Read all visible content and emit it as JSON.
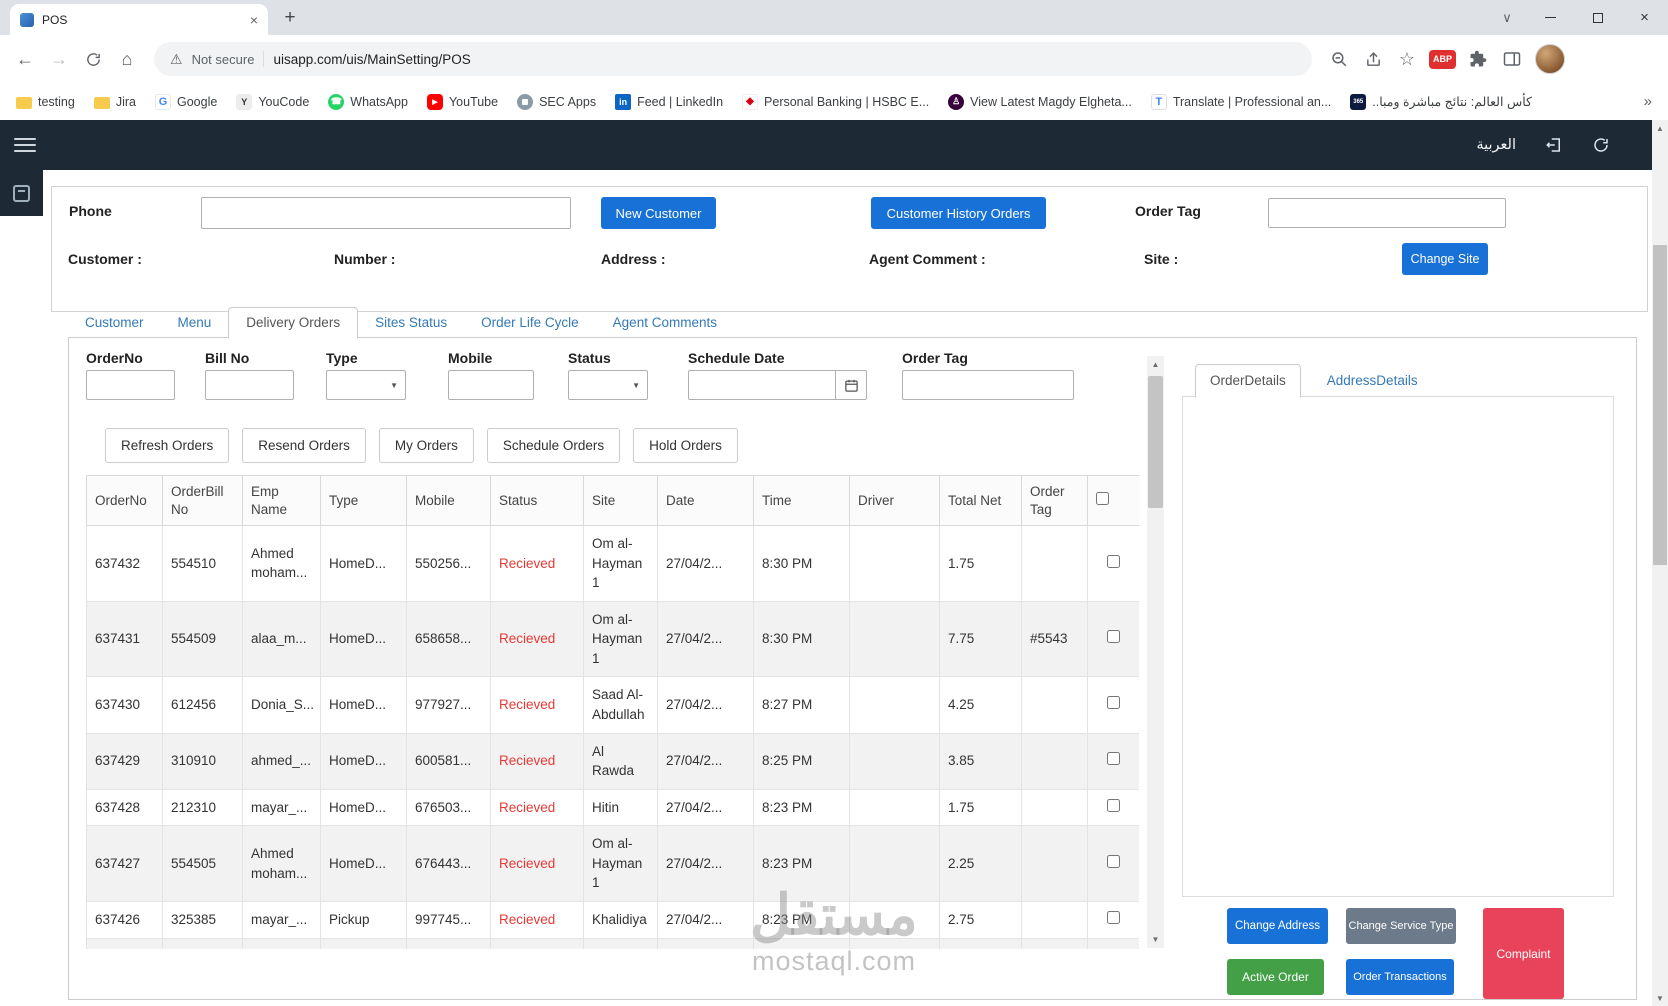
{
  "browser": {
    "tab_title": "POS",
    "security_label": "Not secure",
    "url": "uisapp.com/uis/MainSetting/POS",
    "abp_badge": "ABP",
    "bookmarks": [
      "testing",
      "Jira",
      "Google",
      "YouCode",
      "WhatsApp",
      "YouTube",
      "SEC Apps",
      "Feed | LinkedIn",
      "Personal Banking | HSBC E...",
      "View Latest Magdy Elgheta...",
      "Translate | Professional an...",
      "كأس العالم: نتائج مباشرة ومبا.."
    ]
  },
  "app_header": {
    "language": "العربية"
  },
  "customer_form": {
    "phone_label": "Phone",
    "new_customer": "New Customer",
    "customer_history": "Customer History Orders",
    "order_tag_label": "Order Tag",
    "customer_label": "Customer :",
    "number_label": "Number :",
    "address_label": "Address :",
    "agent_comment_label": "Agent Comment :",
    "site_label": "Site :",
    "change_site": "Change Site"
  },
  "nav_tabs": [
    "Customer",
    "Menu",
    "Delivery Orders",
    "Sites Status",
    "Order Life Cycle",
    "Agent Comments"
  ],
  "filters": {
    "order_no": "OrderNo",
    "bill_no": "Bill No",
    "type": "Type",
    "mobile": "Mobile",
    "status": "Status",
    "schedule_date": "Schedule Date",
    "order_tag": "Order Tag"
  },
  "order_actions": [
    "Refresh Orders",
    "Resend Orders",
    "My Orders",
    "Schedule Orders",
    "Hold Orders"
  ],
  "orders_table": {
    "columns": [
      "OrderNo",
      "OrderBill No",
      "Emp Name",
      "Type",
      "Mobile",
      "Status",
      "Site",
      "Date",
      "Time",
      "Driver",
      "Total Net",
      "Order Tag"
    ],
    "rows": [
      {
        "order_no": "637432",
        "bill_no": "554510",
        "emp": "Ahmed moham...",
        "type": "HomeD...",
        "mobile": "550256...",
        "status": "Recieved",
        "site": "Om al-Hayman 1",
        "date": "27/04/2...",
        "time": "8:30 PM",
        "driver": "",
        "total": "1.75",
        "tag": ""
      },
      {
        "order_no": "637431",
        "bill_no": "554509",
        "emp": "alaa_m...",
        "type": "HomeD...",
        "mobile": "658658...",
        "status": "Recieved",
        "site": "Om al-Hayman 1",
        "date": "27/04/2...",
        "time": "8:30 PM",
        "driver": "",
        "total": "7.75",
        "tag": "#5543"
      },
      {
        "order_no": "637430",
        "bill_no": "612456",
        "emp": "Donia_S...",
        "type": "HomeD...",
        "mobile": "977927...",
        "status": "Recieved",
        "site": "Saad Al-Abdullah",
        "date": "27/04/2...",
        "time": "8:27 PM",
        "driver": "",
        "total": "4.25",
        "tag": ""
      },
      {
        "order_no": "637429",
        "bill_no": "310910",
        "emp": "ahmed_...",
        "type": "HomeD...",
        "mobile": "600581...",
        "status": "Recieved",
        "site": "Al Rawda",
        "date": "27/04/2...",
        "time": "8:25 PM",
        "driver": "",
        "total": "3.85",
        "tag": ""
      },
      {
        "order_no": "637428",
        "bill_no": "212310",
        "emp": "mayar_...",
        "type": "HomeD...",
        "mobile": "676503...",
        "status": "Recieved",
        "site": "Hitin",
        "date": "27/04/2...",
        "time": "8:23 PM",
        "driver": "",
        "total": "1.75",
        "tag": ""
      },
      {
        "order_no": "637427",
        "bill_no": "554505",
        "emp": "Ahmed moham...",
        "type": "HomeD...",
        "mobile": "676443...",
        "status": "Recieved",
        "site": "Om al-Hayman 1",
        "date": "27/04/2...",
        "time": "8:23 PM",
        "driver": "",
        "total": "2.25",
        "tag": ""
      },
      {
        "order_no": "637426",
        "bill_no": "325385",
        "emp": "mayar_...",
        "type": "Pickup",
        "mobile": "997745...",
        "status": "Recieved",
        "site": "Khalidiya",
        "date": "27/04/2...",
        "time": "8:23 PM",
        "driver": "",
        "total": "2.75",
        "tag": ""
      }
    ]
  },
  "details_panel": {
    "tabs": [
      "OrderDetails",
      "AddressDetails"
    ],
    "buttons": {
      "change_address": "Change Address",
      "change_service_type": "Change Service Type",
      "complaint": "Complaint",
      "active_order": "Active Order",
      "order_transactions": "Order Transactions"
    }
  },
  "watermark": {
    "arabic": "مستقل",
    "site": "mostaql.com"
  },
  "colors": {
    "primary_blue": "#1771d6",
    "status_red": "#e53935",
    "complaint_red": "#e8435a",
    "active_green": "#43a047",
    "service_gray": "#6c7a89",
    "header_dark": "#1d2935"
  }
}
